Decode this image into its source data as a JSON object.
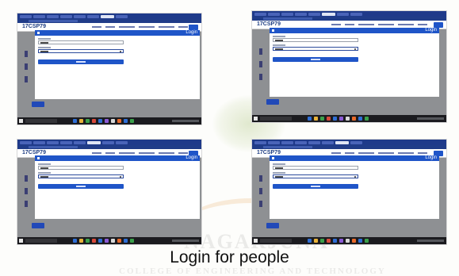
{
  "caption": "Login for people",
  "watermark": {
    "text_line1": "NAGARJUNA",
    "text_line2": "COLLEGE OF ENGINEERING AND TECHNOLOGY"
  },
  "screenshots": [
    {
      "brand": "17CSP79",
      "modal_title": "Login"
    },
    {
      "brand": "17CSP79",
      "modal_title": "Login"
    },
    {
      "brand": "17CSP79",
      "modal_title": "Login"
    },
    {
      "brand": "17CSP79",
      "modal_title": "Login"
    }
  ],
  "colors": {
    "browser_chrome": "#1f3a8a",
    "modal_header": "#1f55c8",
    "page_overlay": "#8e9093",
    "taskbar": "#1b1b1f"
  },
  "icons": [
    "windows-start-icon",
    "password-visibility-icon",
    "modal-close-icon"
  ]
}
